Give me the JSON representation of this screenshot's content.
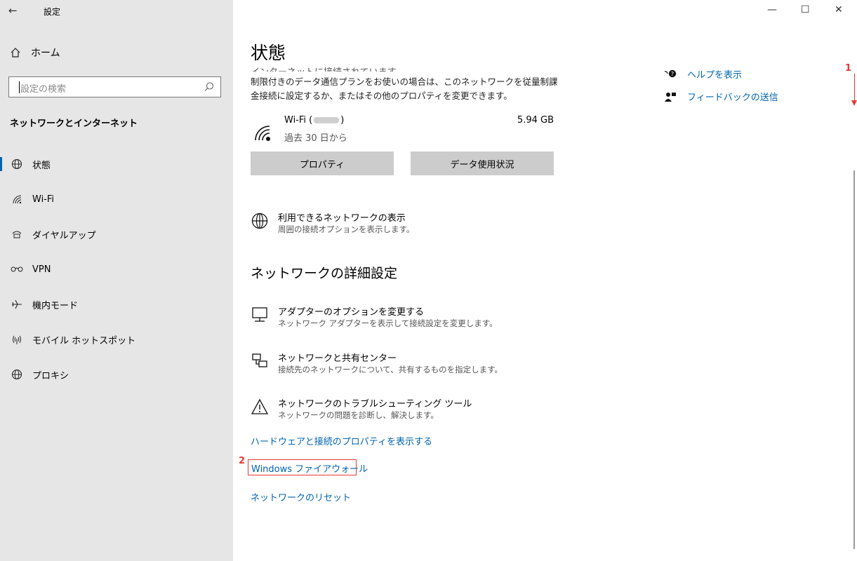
{
  "window": {
    "title": "設定",
    "back_glyph": "←",
    "minimize_glyph": "—",
    "maximize_glyph": "☐",
    "close_glyph": "✕"
  },
  "sidebar": {
    "home_label": "ホーム",
    "search_placeholder": "設定の検索",
    "section_title": "ネットワークとインターネット",
    "items": [
      {
        "label": "状態",
        "icon": "globe-status-icon"
      },
      {
        "label": "Wi-Fi",
        "icon": "wifi-icon"
      },
      {
        "label": "ダイヤルアップ",
        "icon": "dialup-icon"
      },
      {
        "label": "VPN",
        "icon": "vpn-icon"
      },
      {
        "label": "機内モード",
        "icon": "airplane-icon"
      },
      {
        "label": "モバイル ホットスポット",
        "icon": "hotspot-icon"
      },
      {
        "label": "プロキシ",
        "icon": "proxy-icon"
      }
    ]
  },
  "main": {
    "title": "状態",
    "partial_text": "インターネットに接続されています",
    "description": "制限付きのデータ通信プランをお使いの場合は、このネットワークを従量制課金接続に設定するか、またはその他のプロパティを変更できます。",
    "wifi": {
      "name_prefix": "Wi-Fi (",
      "name_suffix": ")",
      "since": "過去 30 日から",
      "usage": "5.94 GB"
    },
    "buttons": {
      "properties": "プロパティ",
      "data_usage": "データ使用状況"
    },
    "available_networks": {
      "title": "利用できるネットワークの表示",
      "subtitle": "周囲の接続オプションを表示します。"
    },
    "advanced_heading": "ネットワークの詳細設定",
    "advanced": [
      {
        "title": "アダプターのオプションを変更する",
        "subtitle": "ネットワーク アダプターを表示して接続設定を変更します。"
      },
      {
        "title": "ネットワークと共有センター",
        "subtitle": "接続先のネットワークについて、共有するものを指定します。"
      },
      {
        "title": "ネットワークのトラブルシューティング ツール",
        "subtitle": "ネットワークの問題を診断し、解決します。"
      }
    ],
    "links": {
      "hardware": "ハードウェアと接続のプロパティを表示する",
      "firewall": "Windows ファイアウォール",
      "reset": "ネットワークのリセット"
    }
  },
  "right_panel": {
    "help": "ヘルプを表示",
    "feedback": "フィードバックの送信"
  },
  "annotations": {
    "step1": "1",
    "step2": "2",
    "color": "#e53935"
  },
  "colors": {
    "accent": "#0063b1",
    "sidebar_bg": "#e6e6e6",
    "button_bg": "#cccccc"
  }
}
